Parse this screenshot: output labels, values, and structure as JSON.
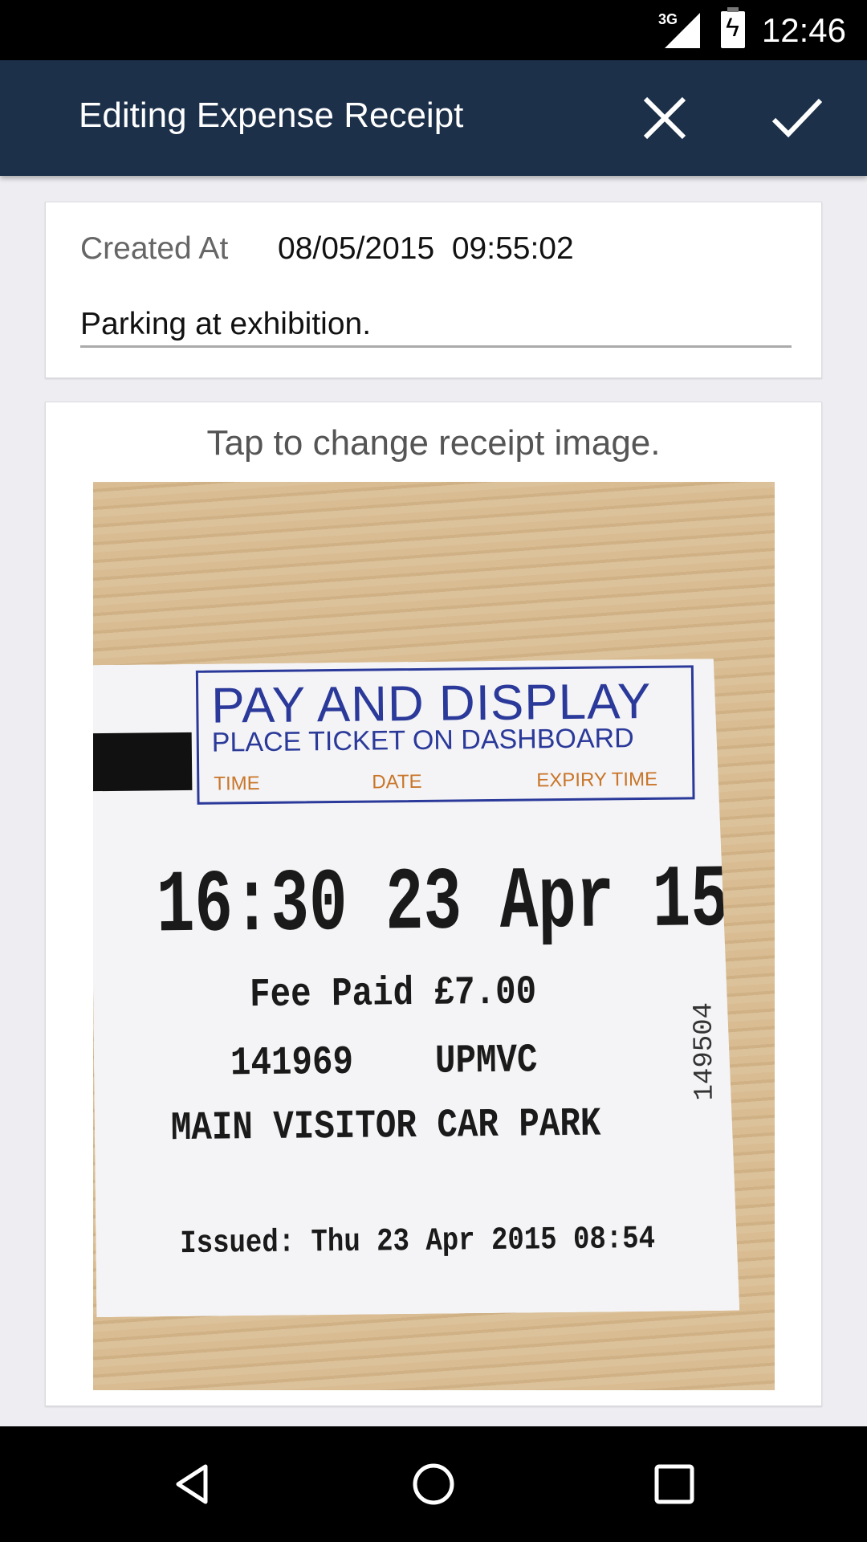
{
  "status_bar": {
    "network": "3G",
    "time": "12:46"
  },
  "app_bar": {
    "title": "Editing Expense Receipt",
    "cancel_icon": "close-icon",
    "confirm_icon": "check-icon"
  },
  "details": {
    "created_label": "Created At",
    "created_value": "08/05/2015  09:55:02",
    "note_value": "Parking at exhibition."
  },
  "receipt": {
    "hint": "Tap to change receipt image.",
    "ticket": {
      "heading": "PAY AND DISPLAY",
      "subheading": "PLACE TICKET ON DASHBOARD",
      "col_time": "TIME",
      "col_date": "DATE",
      "col_expiry": "EXPIRY TIME",
      "expiry": "16:30 23 Apr 15",
      "fee": "Fee Paid £7.00",
      "ref": "141969    UPMVC",
      "location": "MAIN VISITOR CAR PARK",
      "issued": "Issued: Thu 23 Apr 2015 08:54",
      "serial": "149504"
    }
  },
  "nav_bar": {
    "back": "back-icon",
    "home": "home-icon",
    "recents": "recents-icon"
  }
}
